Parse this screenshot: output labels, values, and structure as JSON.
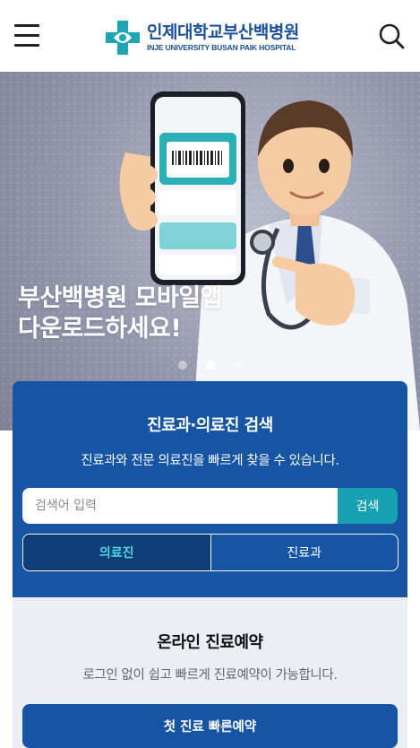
{
  "header": {
    "logo_ko": "인제대학교부산백병원",
    "logo_en": "INJE UNIVERSITY BUSAN PAIK HOSPITAL",
    "menu_icon": "hamburger-menu-icon",
    "search_icon": "search-icon",
    "brand_color": "#1b4f9c",
    "logo_accent": "#1fa5b4"
  },
  "hero": {
    "title_line1": "부산백병원 모바일앱",
    "title_line2": "다운로드하세요!",
    "slide_count": 3,
    "active_slide": 2
  },
  "search": {
    "title": "진료과·의료진 검색",
    "subtitle": "진료과와 전문 의료진을 빠르게 찾을 수 있습니다.",
    "placeholder": "검색어 입력",
    "button_label": "검색",
    "tabs": [
      {
        "label": "의료진",
        "active": true
      },
      {
        "label": "진료과",
        "active": false
      }
    ],
    "bg_color": "#1555a4",
    "button_color": "#16a0b0"
  },
  "reservation": {
    "title": "온라인 진료예약",
    "subtitle": "로그인 없이 쉽고 빠르게 진료예약이 가능합니다.",
    "button_label": "첫 진료 빠른예약"
  }
}
